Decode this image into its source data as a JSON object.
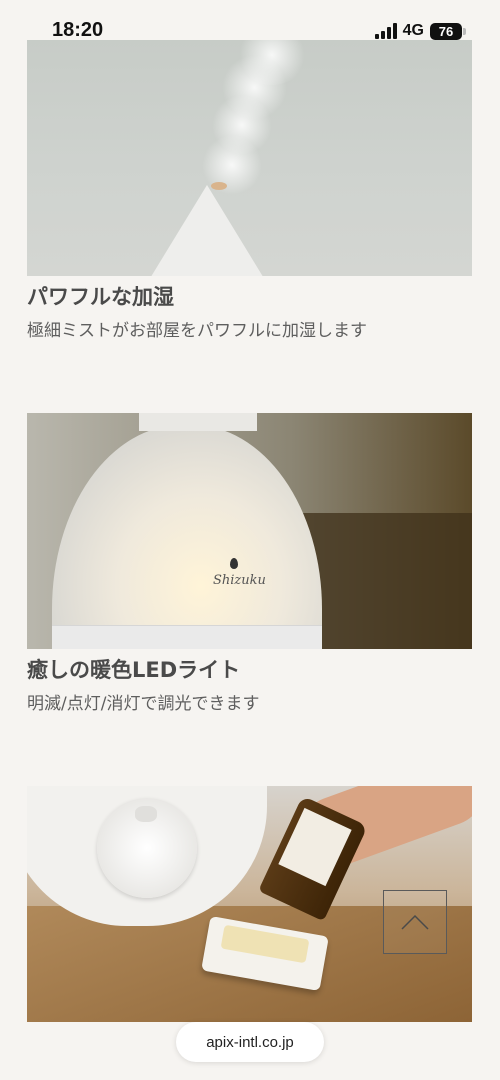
{
  "status_bar": {
    "time": "18:20",
    "network": "4G",
    "battery": "76"
  },
  "features": [
    {
      "title": "パワフルな加湿",
      "description": "極細ミストがお部屋をパワフルに加湿します",
      "image": "humidifier-mist-photo"
    },
    {
      "title": "癒しの暖色LEDライト",
      "description": "明滅/点灯/消灯で調光できます",
      "image": "led-lamp-photo",
      "logo_text": "Shizuku"
    },
    {
      "title": "",
      "description": "",
      "image": "aroma-oil-photo"
    }
  ],
  "back_to_top": {
    "icon": "chevron-up-icon"
  },
  "browser": {
    "url": "apix-intl.co.jp"
  }
}
